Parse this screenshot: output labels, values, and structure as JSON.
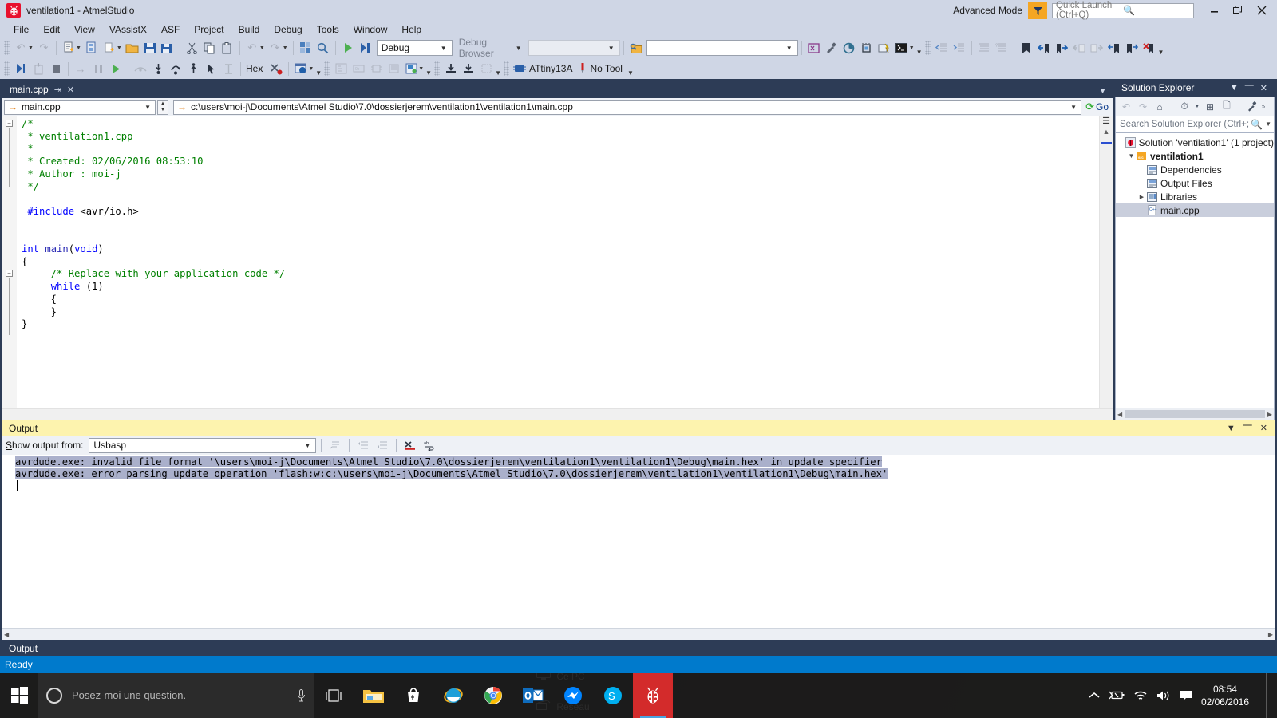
{
  "window": {
    "title": "ventilation1 - AtmelStudio",
    "app_icon": "atmel-ladybug-icon",
    "advanced_mode": "Advanced Mode",
    "quick_launch_placeholder": "Quick Launch (Ctrl+Q)",
    "minimize": "–",
    "restore": "❐",
    "close": "✕"
  },
  "menu": {
    "items": [
      "File",
      "Edit",
      "View",
      "VAssistX",
      "ASF",
      "Project",
      "Build",
      "Debug",
      "Tools",
      "Window",
      "Help"
    ]
  },
  "toolbar1": {
    "config_combo": "Debug",
    "debug_browser": "Debug Browser",
    "empty_combo": "",
    "find_combo": ""
  },
  "toolbar2": {
    "hex_label": "Hex",
    "device": "ATtiny13A",
    "tool": "No Tool"
  },
  "editor": {
    "tab_label": "main.cpp",
    "tab_pin": "⇥",
    "tab_close": "✕",
    "nav_member": "main.cpp",
    "file_path": "c:\\users\\moi-j\\Documents\\Atmel Studio\\7.0\\dossierjerem\\ventilation1\\ventilation1\\main.cpp",
    "go_label": "Go",
    "code_lines": [
      "/*",
      " * ventilation1.cpp",
      " *",
      " * Created: 02/06/2016 08:53:10",
      " * Author : moi-j",
      " */",
      "",
      "#include <avr/io.h>",
      "",
      "",
      "int main(void)",
      "{",
      "    /* Replace with your application code */",
      "    while (1)",
      "    {",
      "    }",
      "}"
    ]
  },
  "solution_explorer": {
    "title": "Solution Explorer",
    "dropdown_icon": "chevron-down-icon",
    "pin_icon": "pin-icon",
    "close_icon": "close-icon",
    "search_placeholder": "Search Solution Explorer (Ctrl+;",
    "tree": [
      {
        "label": "Solution 'ventilation1' (1 project)",
        "icon": "solution-icon",
        "indent": 0,
        "expander": "",
        "bold": false,
        "selected": false
      },
      {
        "label": "ventilation1",
        "icon": "project-icon",
        "indent": 1,
        "expander": "▲",
        "bold": true,
        "selected": false
      },
      {
        "label": "Dependencies",
        "icon": "dependencies-icon",
        "indent": 2,
        "expander": "",
        "bold": false,
        "selected": false
      },
      {
        "label": "Output Files",
        "icon": "output-files-icon",
        "indent": 2,
        "expander": "",
        "bold": false,
        "selected": false
      },
      {
        "label": "Libraries",
        "icon": "libraries-icon",
        "indent": 2,
        "expander": "▶",
        "bold": false,
        "selected": false
      },
      {
        "label": "main.cpp",
        "icon": "cpp-file-icon",
        "indent": 2,
        "expander": "",
        "bold": false,
        "selected": true
      }
    ]
  },
  "output": {
    "title": "Output",
    "show_output_from_label": "Show output from:",
    "source": "Usbasp",
    "lines": [
      "avrdude.exe: invalid file format '\\users\\moi-j\\Documents\\Atmel Studio\\7.0\\dossierjerem\\ventilation1\\ventilation1\\Debug\\main.hex' in update specifier",
      "avrdude.exe: error parsing update operation 'flash:w:c:\\users\\moi-j\\Documents\\Atmel Studio\\7.0\\dossierjerem\\ventilation1\\ventilation1\\Debug\\main.hex'"
    ],
    "footer_tab": "Output"
  },
  "status": {
    "text": "Ready"
  },
  "taskbar": {
    "cortana_placeholder": "Posez-moi une question.",
    "buttons": [
      {
        "name": "task-view",
        "icon": "task-view-icon"
      },
      {
        "name": "file-explorer",
        "icon": "folder-icon"
      },
      {
        "name": "microsoft-store",
        "icon": "store-icon"
      },
      {
        "name": "internet-explorer",
        "icon": "ie-icon"
      },
      {
        "name": "google-chrome",
        "icon": "chrome-icon"
      },
      {
        "name": "outlook",
        "icon": "outlook-icon"
      },
      {
        "name": "messenger",
        "icon": "messenger-icon"
      },
      {
        "name": "skype",
        "icon": "skype-icon"
      },
      {
        "name": "atmel-studio",
        "icon": "atmel-ladybug-icon"
      }
    ],
    "tray": [
      "show-hidden-icons",
      "battery-icon",
      "wifi-icon",
      "volume-icon",
      "action-center-icon"
    ],
    "time": "08:54",
    "date": "02/06/2016"
  },
  "desktop": {
    "icons": [
      {
        "label": "Ce PC",
        "icon": "this-pc-icon"
      },
      {
        "label": "Réseau",
        "icon": "network-icon"
      }
    ]
  },
  "colors": {
    "accent": "#007acc",
    "chrome": "#cfd6e5",
    "panel_dark": "#2d3c56",
    "output_header": "#fdf3ae",
    "flag": "#f5a623",
    "brand_red": "#e8112d"
  }
}
